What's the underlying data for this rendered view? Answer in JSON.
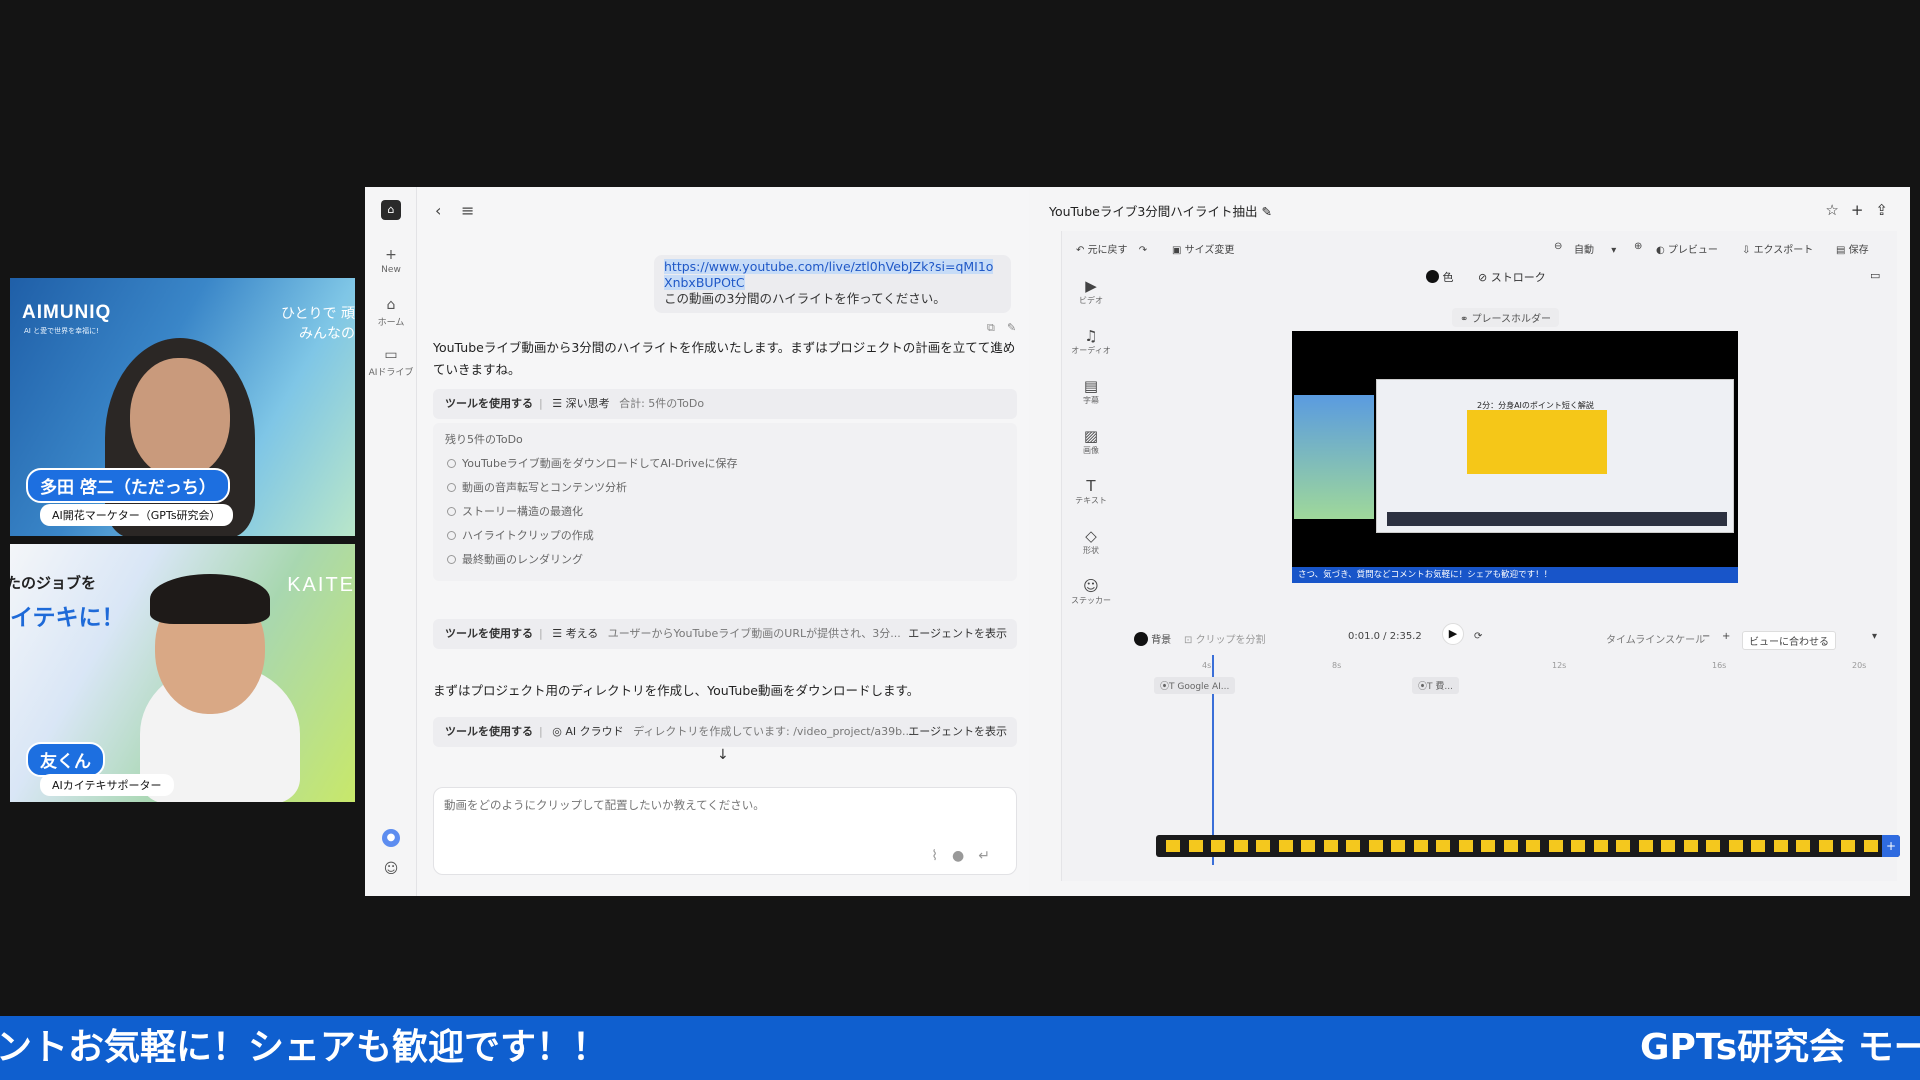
{
  "cam1": {
    "brand": "AIMUNIQ",
    "brand_sub": "AI と愛で世界を幸福に!",
    "slogan_line1": "ひとりで 頑",
    "slogan_line2": "みんなの",
    "name": "多田 啓二（ただっち）",
    "role": "AI開花マーケター（GPTs研究会）"
  },
  "cam2": {
    "ad_line1": "たのジョブを",
    "ad_line2": "イテキに！",
    "kaite": "KAITE",
    "name": "友くん",
    "role": "AIカイテキサポーター"
  },
  "rail": {
    "new": "New",
    "home": "ホーム",
    "drive": "AIドライブ"
  },
  "chat": {
    "user_url": "https://www.youtube.com/live/ztl0hVebJZk?si=qMI1oXnbxBUPOtC",
    "user_text": "この動画の3分間のハイライトを作ってください。",
    "reply1": "YouTubeライブ動画から3分間のハイライトを作成いたします。まずはプロジェクトの計画を立てて進めていきますね。",
    "tool1": {
      "label": "ツールを使用する",
      "name": "深い思考",
      "detail": "合計: 5件のToDo"
    },
    "todo_title": "残り5件のToDo",
    "todos": [
      "YouTubeライブ動画をダウンロードしてAI-Driveに保存",
      "動画の音声転写とコンテンツ分析",
      "ストーリー構造の最適化",
      "ハイライトクリップの作成",
      "最終動画のレンダリング"
    ],
    "tool2": {
      "label": "ツールを使用する",
      "name": "考える",
      "detail": "ユーザーからYouTubeライブ動画のURLが提供され、3分...",
      "button": "エージェントを表示"
    },
    "reply2": "まずはプロジェクト用のディレクトリを作成し、YouTube動画をダウンロードします。",
    "tool3": {
      "label": "ツールを使用する",
      "name": "AI クラウド",
      "detail": "ディレクトリを作成しています: /video_project/a39b...",
      "button": "エージェントを表示"
    },
    "input_placeholder": "動画をどのようにクリップして配置したいか教えてください。"
  },
  "editor": {
    "title": "YouTubeライブ3分間ハイライト抽出",
    "undo": "元に戻す",
    "resize": "サイズ変更",
    "zoom": "自動",
    "preview": "プレビュー",
    "export": "エクスポート",
    "save": "保存",
    "color": "色",
    "stroke": "ストローク",
    "placeholder": "プレースホルダー",
    "tools": [
      "ビデオ",
      "オーディオ",
      "字幕",
      "画像",
      "テキスト",
      "形状",
      "ステッカー"
    ],
    "canvas_ticker": "さつ、気づき、質問などコメントお気軽に！シェアも歓迎です！！",
    "canvas_inner_title": "2分：分身AIのポイント短く解説",
    "background": "背景",
    "split": "クリップを分割",
    "time": "0:01.0 / 2:35.2",
    "timeline_scale": "タイムラインスケール",
    "fit_view": "ビューに合わせる",
    "ruler": [
      "4s",
      "8s",
      "12s",
      "16s",
      "20s"
    ],
    "clip1": "Google AI...",
    "clip2": "費..."
  },
  "ticker": {
    "left": "ントお気軽に！シェアも歓迎です！！",
    "right": "GPTs研究会 モー"
  },
  "colors": {
    "accent": "#1d6fe0",
    "ticker": "#0f5fcf",
    "playhead": "#3a6fd8"
  }
}
